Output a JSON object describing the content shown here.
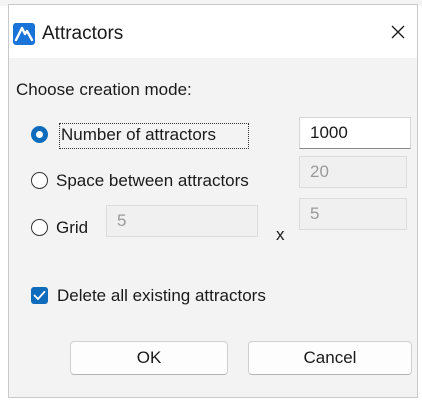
{
  "dialog": {
    "title": "Attractors",
    "icon": "app-logo-icon",
    "accent_color": "#0f6cbd"
  },
  "mode": {
    "label": "Choose creation mode:",
    "options": [
      {
        "label": "Number of attractors",
        "selected": true,
        "value": "1000"
      },
      {
        "label": "Space between attractors",
        "selected": false,
        "value": "20"
      },
      {
        "label": "Grid",
        "selected": false,
        "value_x": "5",
        "separator": "x",
        "value_y": "5"
      }
    ]
  },
  "delete_existing": {
    "label": "Delete all existing attractors",
    "checked": true
  },
  "buttons": {
    "ok": "OK",
    "cancel": "Cancel"
  }
}
